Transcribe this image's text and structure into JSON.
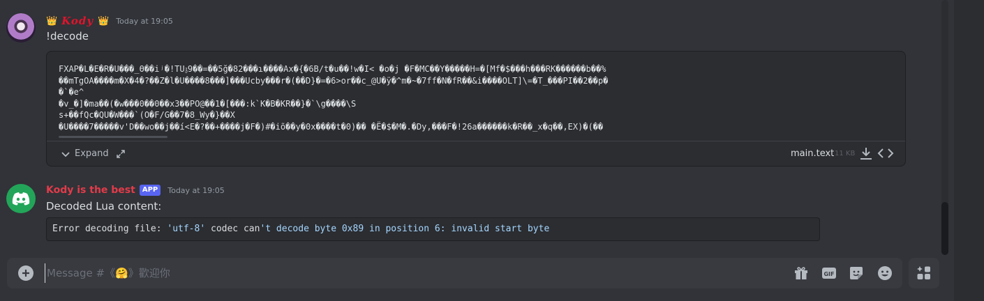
{
  "messages": {
    "user": {
      "name": "Kody",
      "crown_left": "👑",
      "crown_right": "👑",
      "timestamp": "Today at 19:05",
      "text": "!decode",
      "attachment": {
        "lines": [
          "FXAP�L�E�R�U���_ϴ��iʲ�!TU𝔷9��=��5ğ�82���ɿ����Ax�{�6B/t�u��!w�I< �o�j �F�MC��Y�����H=�[Mf�$���h���RK������b��%",
          "��mTgOA����m�X�4�?��Z�l�U����8���]���Ucby���r�(��D}�=�6>or��c_@U�ÿ�^m�~�7ff�N�fR��&i����OLT]\\=�T_���PI��2��p�",
          "�`�e^",
          "�v_�]�ma��(�w���0��0��x3��PO@��1�[���:k`K�B�KR��}�`\\g����\\S",
          "s+��fQc�QU�W���`(O�F/G��7�8_Wy�}��X",
          "�U����7�����v'D��wo��j��í<E�?��+����j�F�)#�iõ��y�0x����t�0)�� �Ë�$�M�.�Dy,���F�!26a������k�R��_x�q��,EX)�(��"
        ],
        "expand_label": "Expand",
        "filename": "main.text",
        "filesize": "11 KB"
      }
    },
    "bot": {
      "name": "Kody is the best",
      "tag": "APP",
      "timestamp": "Today at 19:05",
      "text": "Decoded Lua content:",
      "error": {
        "p1": "Error decoding file: ",
        "p2": "'utf-8'",
        "p3": " codec can",
        "p4": "'t decode byte 0x89 in position 6: invalid start byte"
      }
    }
  },
  "composer": {
    "placeholder": "Message #《🤗》歡迎你"
  },
  "icons": [
    "gift-icon",
    "gif-icon",
    "sticker-icon",
    "emoji-icon",
    "apps-icon",
    "plus-icon",
    "download-icon",
    "code-view-icon",
    "chevron-down-icon",
    "expand-arrows-icon",
    "discord-logo-icon"
  ],
  "colors": {
    "background": "#313338",
    "user_name": "#e0142b",
    "bot_name": "#e33b4a",
    "app_tag": "#5865f2",
    "bot_avatar": "#23a559"
  }
}
